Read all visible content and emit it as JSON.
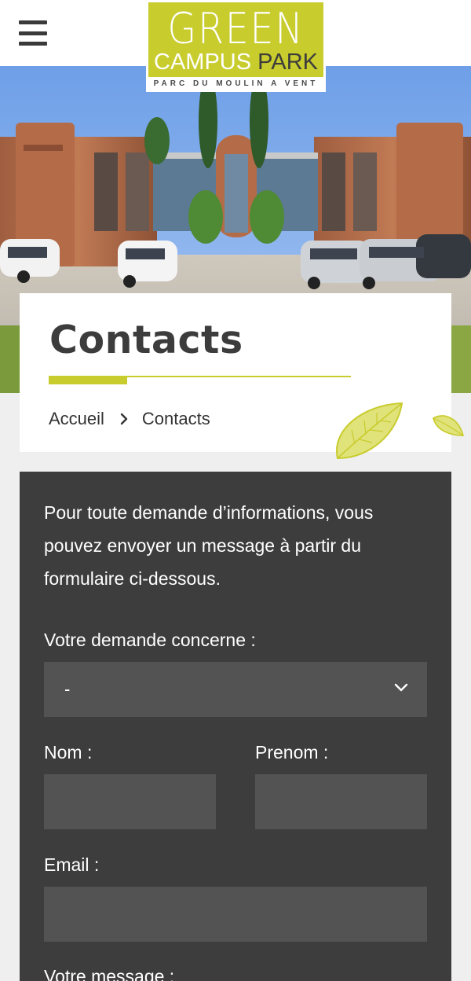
{
  "header": {
    "menu_icon": "hamburger-icon",
    "logo": {
      "line1": "GREEN",
      "line2_a": "CAMPUS",
      "line2_b": "PARK",
      "tagline": "PARC DU MOULIN A VENT"
    }
  },
  "page": {
    "title": "Contacts",
    "breadcrumb": {
      "home": "Accueil",
      "separator_icon": "chevron-right-icon",
      "current": "Contacts"
    }
  },
  "form": {
    "intro": "Pour toute demande d’informations, vous pouvez envoyer un message à partir du formulaire ci-dessous.",
    "subject_label": "Votre demande concerne :",
    "subject_value": "-",
    "nom_label": "Nom :",
    "nom_value": "",
    "prenom_label": "Prenom :",
    "prenom_value": "",
    "email_label": "Email :",
    "email_value": "",
    "message_label": "Votre message :"
  },
  "colors": {
    "accent": "#c8cc2c",
    "panel": "#3d3d3d",
    "field": "#535353",
    "text_dark": "#3c3c3c",
    "page_bg": "#efefef"
  }
}
